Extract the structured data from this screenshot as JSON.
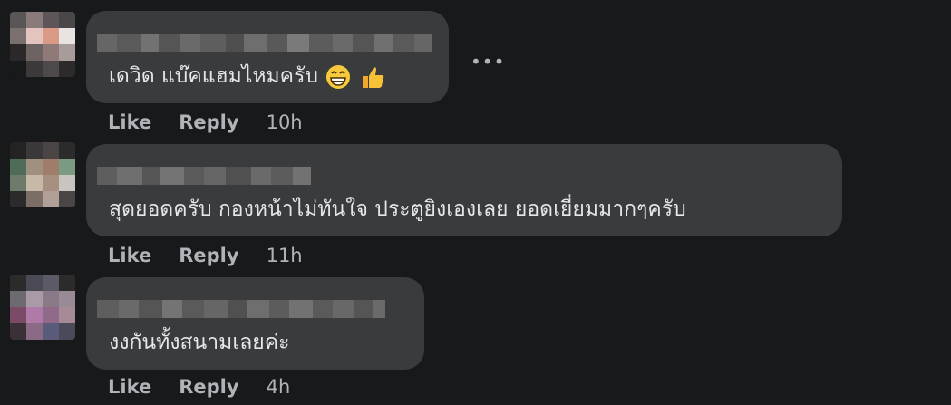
{
  "comments": [
    {
      "text": "เดวิด แบ๊คแฮมไหมครับ",
      "emoji": [
        "grinning-face-emoji",
        "thumbs-up-emoji"
      ],
      "like_label": "Like",
      "reply_label": "Reply",
      "time": "10h"
    },
    {
      "text": "สุดยอดครับ กองหน้าไม่ทันใจ ประตูยิงเองเลย ยอดเยี่ยมมากๆครับ",
      "like_label": "Like",
      "reply_label": "Reply",
      "time": "11h"
    },
    {
      "text": "งงกันทั้งสนามเลยค่ะ",
      "like_label": "Like",
      "reply_label": "Reply",
      "time": "4h"
    }
  ],
  "more_options": "•••",
  "colors": {
    "background": "#18191a",
    "bubble": "#3a3b3c",
    "text": "#e4e6eb",
    "secondary": "#b0b3b8"
  }
}
